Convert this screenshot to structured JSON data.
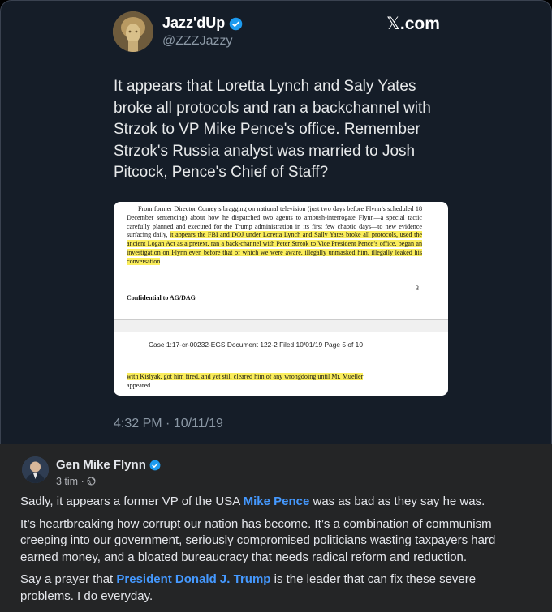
{
  "tweet": {
    "author_name": "Jazz'dUp",
    "author_handle": "@ZZZJazzy",
    "source_label": ".com",
    "text": "It appears that Loretta Lynch and Saly Yates broke all protocols and ran a backchannel with Strzok to VP Mike Pence's office. Remember Strzok's Russia analyst was married to Josh Pitcock, Pence's Chief of Staff?",
    "timestamp": "4:32 PM · 10/11/19",
    "document": {
      "para_plain": "From former Director Comey’s bragging on national television (just two days before Flynn’s scheduled 18 December sentencing) about how he dispatched two agents to ambush-interrogate Flynn—a special tactic carefully planned and executed for the Trump administration in its first few chaotic days—to new evidence surfacing daily, ",
      "para_highlight": "it appears the FBI and DOJ under Loretta Lynch and Sally Yates broke all protocols, used the ancient Logan Act as a pretext, ran a back-channel with Peter Strzok to Vice President Pence’s office, began an investigation on Flynn even before that of which we were aware, illegally unmasked him, illegally leaked his conversation",
      "page_number": "3",
      "confidential": "Confidential to AG/DAG",
      "case_header": "Case 1:17-cr-00232-EGS   Document 122-2   Filed 10/01/19   Page 5 of 10",
      "continuation_highlight": "with Kislyak, got him fired, and yet still cleared him of any wrongdoing until Mr. Mueller",
      "continuation_plain": "appeared."
    }
  },
  "fb_post": {
    "author_name": "Gen Mike Flynn",
    "time_ago": "3 tim",
    "separator": "·",
    "privacy_icon": "globe-icon",
    "p1_before": "Sadly, it appears a former VP of the USA ",
    "p1_mention": "Mike Pence",
    "p1_after": " was as bad as they say he was.",
    "p2": "It’s heartbreaking how corrupt our nation has become. It’s a combination of communism creeping into our government, seriously compromised politicians wasting  taxpayers hard earned money, and a bloated bureaucracy that needs radical reform and reduction.",
    "p3_before": "Say a prayer that ",
    "p3_mention": "President Donald J. Trump",
    "p3_after": " is the leader that can fix these severe problems. I do everyday."
  },
  "colors": {
    "tweet_bg": "#151d28",
    "fb_bg": "#242526",
    "verified": "#1d9bf0",
    "mention": "#4599ff",
    "highlight": "#fbee5c"
  }
}
